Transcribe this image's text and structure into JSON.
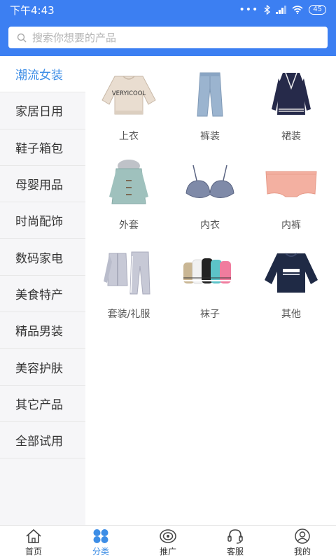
{
  "status": {
    "time": "下午4:43",
    "battery": "45"
  },
  "search": {
    "placeholder": "搜索你想要的产品"
  },
  "sidebar": {
    "items": [
      {
        "label": "潮流女装"
      },
      {
        "label": "家居日用"
      },
      {
        "label": "鞋子箱包"
      },
      {
        "label": "母婴用品"
      },
      {
        "label": "时尚配饰"
      },
      {
        "label": "数码家电"
      },
      {
        "label": "美食特产"
      },
      {
        "label": "精品男装"
      },
      {
        "label": "美容护肤"
      },
      {
        "label": "其它产品"
      },
      {
        "label": "全部试用"
      }
    ]
  },
  "categories": [
    {
      "label": "上衣",
      "icon": "sweatshirt-image",
      "print": "VERYICOOL"
    },
    {
      "label": "裤装",
      "icon": "jeans-image"
    },
    {
      "label": "裙装",
      "icon": "cardigan-dress-image"
    },
    {
      "label": "外套",
      "icon": "coat-image"
    },
    {
      "label": "内衣",
      "icon": "bra-image"
    },
    {
      "label": "内裤",
      "icon": "underwear-image"
    },
    {
      "label": "套装/礼服",
      "icon": "tracksuit-image"
    },
    {
      "label": "袜子",
      "icon": "socks-image"
    },
    {
      "label": "其他",
      "icon": "sweater-image"
    }
  ],
  "tabs": [
    {
      "label": "首页",
      "icon": "home-icon"
    },
    {
      "label": "分类",
      "icon": "category-icon"
    },
    {
      "label": "推广",
      "icon": "promote-icon"
    },
    {
      "label": "客服",
      "icon": "headset-icon"
    },
    {
      "label": "我的",
      "icon": "profile-icon"
    }
  ],
  "colors": {
    "brand": "#3c7ff2",
    "active": "#3c8de6"
  }
}
